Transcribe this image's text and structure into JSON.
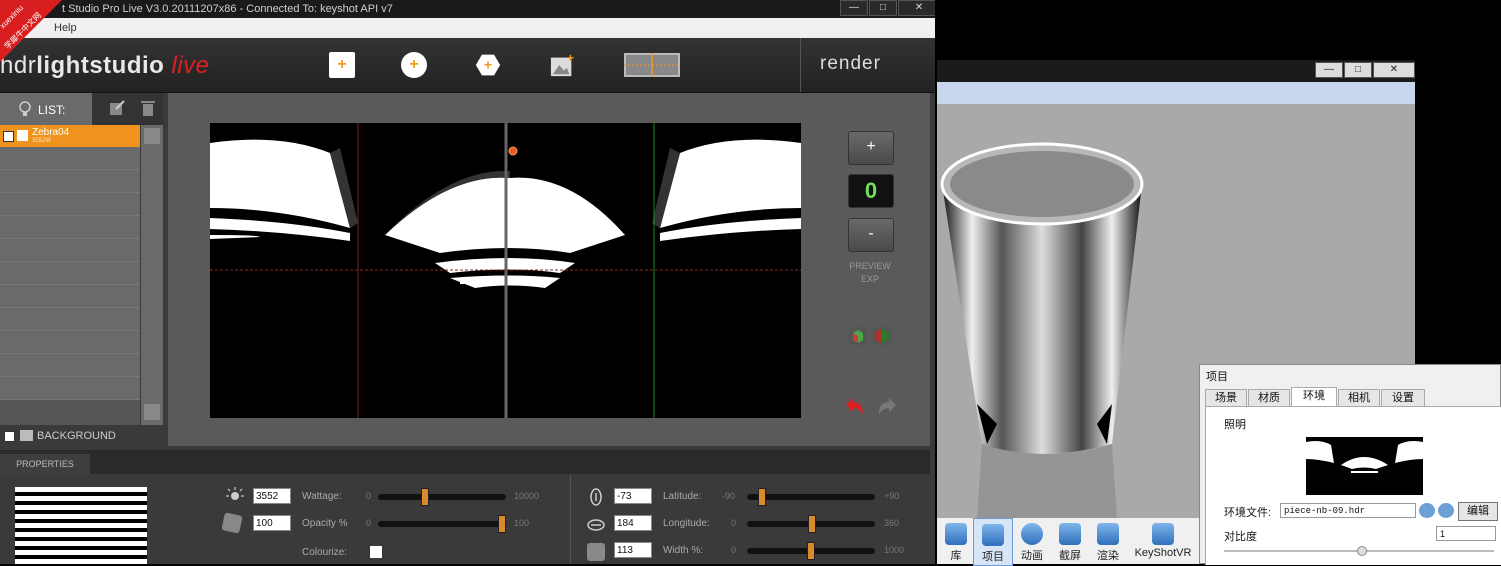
{
  "hdr_window": {
    "title": "t Studio Pro Live V3.0.20111207x86 - Connected To: keyshot API v7",
    "menu_help": "Help",
    "logo_a": "hdr",
    "logo_b": "lightstudio",
    "logo_c": "live",
    "toolbar_icons": [
      "add-rect-light-icon",
      "add-circle-light-icon",
      "add-hexagon-light-icon",
      "add-image-light-icon",
      "panorama-view-icon"
    ],
    "render_label": "render",
    "list_label": "LIST:",
    "light_name": "Zebra04",
    "light_sub": "3552W",
    "background_label": "BACKGROUND",
    "preview_exp": "0",
    "preview_label_1": "PREVIEW",
    "preview_label_2": "EXP",
    "plus": "+",
    "minus": "-"
  },
  "properties": {
    "tab": "PROPERTIES",
    "wattage": {
      "label": "Wattage:",
      "value": "3552",
      "min": "0",
      "max": "10000",
      "fraction": 0.3552
    },
    "opacity": {
      "label": "Opacity %",
      "value": "100",
      "min": "0",
      "max": "100",
      "fraction": 1.0
    },
    "colourize": {
      "label": "Colourize:"
    },
    "latitude": {
      "label": "Latitude:",
      "value": "-73",
      "min": "-90",
      "max": "+90",
      "fraction": 0.094
    },
    "longitude": {
      "label": "Longitude:",
      "value": "184",
      "min": "0",
      "max": "360",
      "fraction": 0.511
    },
    "width": {
      "label": "Width %:",
      "value": "113",
      "min": "0",
      "max": "1000",
      "fraction": 0.5
    }
  },
  "keyshot": {
    "toolbar": [
      "库",
      "项目",
      "动画",
      "截屏",
      "渲染",
      "KeyShotVR"
    ]
  },
  "project_panel": {
    "title": "项目",
    "tabs": [
      "场景",
      "材质",
      "环境",
      "相机",
      "设置"
    ],
    "active_tab": "环境",
    "section": "照明",
    "env_file_label": "环境文件:",
    "env_file_value": "piece-nb-09.hdr",
    "edit_button": "编辑",
    "contrast_label": "对比度",
    "contrast_value": "1"
  },
  "watermark": {
    "line1": "xuexiniu",
    "line2": "学犀牛中文网"
  },
  "window_buttons": {
    "min": "—",
    "max": "□",
    "close": "✕"
  }
}
